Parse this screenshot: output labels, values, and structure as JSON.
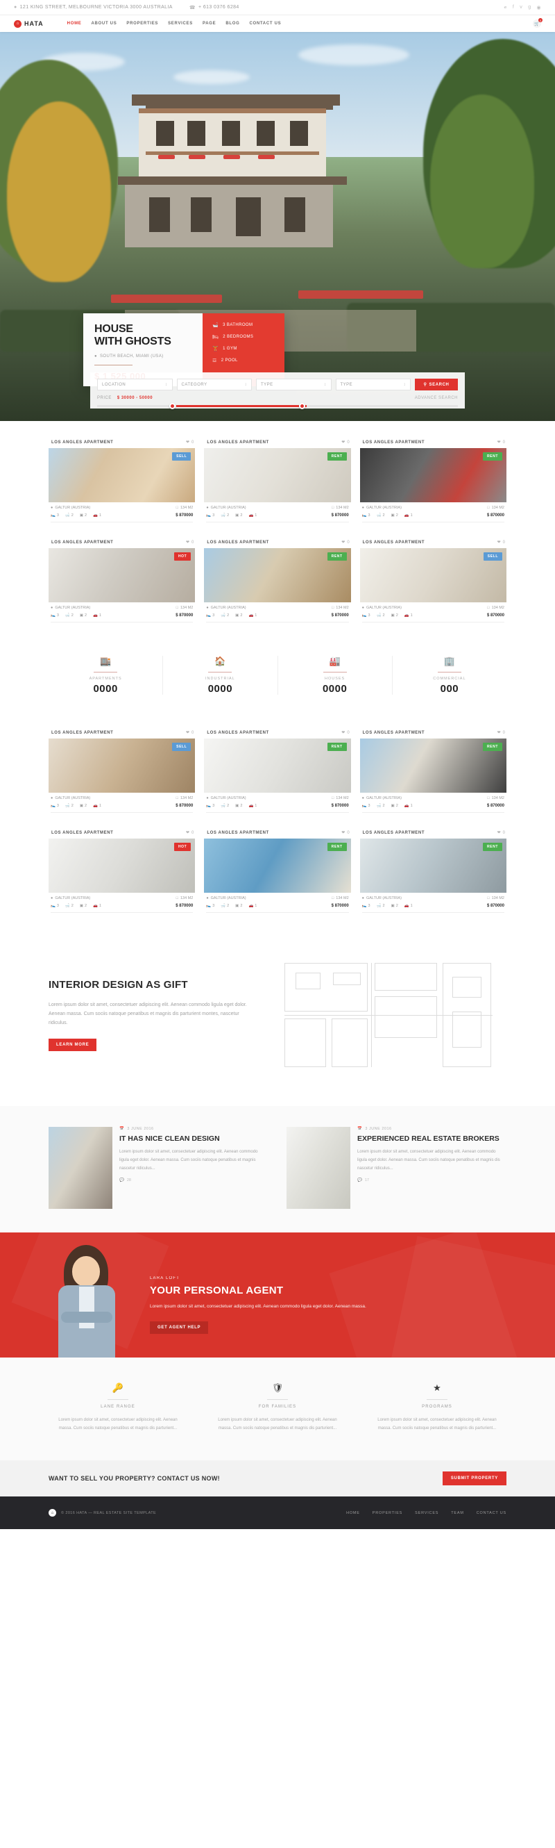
{
  "topbar": {
    "address": "121 KING STREET, MELBOURNE VICTORIA 3000 AUSTRALIA",
    "phone": "+ 613 0376 6284",
    "location_icon": "map-pin-icon",
    "phone_icon": "phone-icon",
    "social": [
      "twitter-icon",
      "facebook-icon",
      "vimeo-icon",
      "google-plus-icon",
      "rss-icon"
    ]
  },
  "nav": {
    "logo": "HATA",
    "logo_mark": "home-icon",
    "items": [
      {
        "label": "HOME",
        "active": true
      },
      {
        "label": "ABOUT US",
        "active": false
      },
      {
        "label": "PROPERTIES",
        "active": false
      },
      {
        "label": "SERVICES",
        "active": false
      },
      {
        "label": "PAGE",
        "active": false
      },
      {
        "label": "BLOG",
        "active": false
      },
      {
        "label": "CONTACT US",
        "active": false
      }
    ],
    "cart_icon": "cart-icon",
    "cart_count": "0"
  },
  "hero": {
    "card": {
      "title_line1": "HOUSE",
      "title_line2": "WITH GHOSTS",
      "location_icon": "map-pin-icon",
      "location": "SOUTH BEACH, MIAMI (USA)",
      "price": "$ 1 525 000",
      "features": [
        {
          "icon": "bathtub-icon",
          "label": "3 BATHROOM"
        },
        {
          "icon": "bed-icon",
          "label": "2 BEDROOMS"
        },
        {
          "icon": "gym-icon",
          "label": "1 GYM"
        },
        {
          "icon": "pool-icon",
          "label": "2 POOL"
        }
      ]
    },
    "search": {
      "fields": [
        {
          "placeholder": "LOCATION"
        },
        {
          "placeholder": "CATEGORY"
        },
        {
          "placeholder": "TYPE"
        },
        {
          "placeholder": "TYPE"
        }
      ],
      "search_label": "SEARCH",
      "search_icon": "search-icon",
      "price_label": "PRICE",
      "price_value": "$ 30000 - 50000",
      "advance_label": "ADVANCE SEARCH"
    }
  },
  "properties_row1": [
    {
      "title": "LOS ANGLES APARTMENT",
      "fav": "0",
      "badge": "SELL",
      "badge_type": "b-sell",
      "location": "GALTUR (AUSTRIA)",
      "area": "134 M2",
      "beds": "3",
      "baths": "2",
      "rooms": "2",
      "garage": "1",
      "price": "$ 870000",
      "img": "alpine-living-room"
    },
    {
      "title": "LOS ANGLES APARTMENT",
      "fav": "0",
      "badge": "RENT",
      "badge_type": "b-rent",
      "location": "GALTUR (AUSTRIA)",
      "area": "134 M2",
      "beds": "3",
      "baths": "2",
      "rooms": "2",
      "garage": "1",
      "price": "$ 870000",
      "img": "white-bedroom"
    },
    {
      "title": "LOS ANGLES APARTMENT",
      "fav": "0",
      "badge": "RENT",
      "badge_type": "b-rent",
      "location": "GALTUR (AUSTRIA)",
      "area": "134 M2",
      "beds": "3",
      "baths": "2",
      "rooms": "2",
      "garage": "1",
      "price": "$ 870000",
      "img": "red-sofa-lounge"
    }
  ],
  "properties_row2": [
    {
      "title": "LOS ANGLES APARTMENT",
      "fav": "0",
      "badge": "HOT",
      "badge_type": "b-hot",
      "location": "GALTUR (AUSTRIA)",
      "area": "134 M2",
      "beds": "3",
      "baths": "2",
      "rooms": "2",
      "garage": "1",
      "price": "$ 870000",
      "img": "grey-sofa-room"
    },
    {
      "title": "LOS ANGLES APARTMENT",
      "fav": "0",
      "badge": "RENT",
      "badge_type": "b-rent",
      "location": "GALTUR (AUSTRIA)",
      "area": "134 M2",
      "beds": "3",
      "baths": "2",
      "rooms": "2",
      "garage": "1",
      "price": "$ 870000",
      "img": "mountain-view-room"
    },
    {
      "title": "LOS ANGLES APARTMENT",
      "fav": "0",
      "badge": "SELL",
      "badge_type": "b-sell",
      "location": "GALTUR (AUSTRIA)",
      "area": "134 M2",
      "beds": "3",
      "baths": "2",
      "rooms": "2",
      "garage": "1",
      "price": "$ 870000",
      "img": "bright-living-room"
    }
  ],
  "stats": [
    {
      "icon": "apartment-icon",
      "label": "APARTMENTS",
      "value": "0000"
    },
    {
      "icon": "industrial-icon",
      "label": "INDUSTRIAL",
      "value": "0000"
    },
    {
      "icon": "factory-icon",
      "label": "HOUSES",
      "value": "0000"
    },
    {
      "icon": "commercial-icon",
      "label": "COMMERCIAL",
      "value": "000"
    }
  ],
  "properties_row3": [
    {
      "title": "LOS ANGLES APARTMENT",
      "fav": "0",
      "badge": "SELL",
      "badge_type": "b-sell",
      "location": "GALTUR (AUSTRIA)",
      "area": "134 M2",
      "beds": "3",
      "baths": "2",
      "rooms": "2",
      "garage": "1",
      "price": "$ 870000",
      "img": "wood-bedroom"
    },
    {
      "title": "LOS ANGLES APARTMENT",
      "fav": "0",
      "badge": "RENT",
      "badge_type": "b-rent",
      "location": "GALTUR (AUSTRIA)",
      "area": "134 M2",
      "beds": "3",
      "baths": "2",
      "rooms": "2",
      "garage": "1",
      "price": "$ 870000",
      "img": "white-kitchen"
    },
    {
      "title": "LOS ANGLES APARTMENT",
      "fav": "0",
      "badge": "RENT",
      "badge_type": "b-rent",
      "location": "GALTUR (AUSTRIA)",
      "area": "134 M2",
      "beds": "3",
      "baths": "2",
      "rooms": "2",
      "garage": "1",
      "price": "$ 870000",
      "img": "dark-lounge"
    }
  ],
  "properties_row4": [
    {
      "title": "LOS ANGLES APARTMENT",
      "fav": "0",
      "badge": "HOT",
      "badge_type": "b-hot",
      "location": "GALTUR (AUSTRIA)",
      "area": "134 M2",
      "beds": "3",
      "baths": "2",
      "rooms": "2",
      "garage": "1",
      "price": "$ 870000",
      "img": "minimal-kitchen"
    },
    {
      "title": "LOS ANGLES APARTMENT",
      "fav": "0",
      "badge": "RENT",
      "badge_type": "b-rent",
      "location": "GALTUR (AUSTRIA)",
      "area": "134 M2",
      "beds": "3",
      "baths": "2",
      "rooms": "2",
      "garage": "1",
      "price": "$ 870000",
      "img": "sea-view-balcony"
    },
    {
      "title": "LOS ANGLES APARTMENT",
      "fav": "0",
      "badge": "RENT",
      "badge_type": "b-rent",
      "location": "GALTUR (AUSTRIA)",
      "area": "134 M2",
      "beds": "3",
      "baths": "2",
      "rooms": "2",
      "garage": "1",
      "price": "$ 870000",
      "img": "glass-wall-lounge"
    }
  ],
  "interior": {
    "title": "INTERIOR DESIGN AS GIFT",
    "text": "Lorem ipsum dolor sit amet, consectetuer adipiscing elit. Aenean commodo ligula eget dolor. Aenean massa. Cum sociis natoque penatibus et magnis dis parturient montes, nascetur ridiculus.",
    "button": "LEARN MORE"
  },
  "blog": [
    {
      "date_icon": "calendar-icon",
      "date": "3 JUNE 2016",
      "title": "IT HAS NICE CLEAN DESIGN",
      "text": "Lorem ipsum dolor sit amet, consectetuer adipiscing elit. Aenean commodo ligula eget dolor. Aenean massa. Cum sociis natoque penatibus et magnis nascetur ridiculus...",
      "comments_icon": "comment-icon",
      "comments": "28"
    },
    {
      "date_icon": "calendar-icon",
      "date": "3 JUNE 2016",
      "title": "EXPERIENCED REAL ESTATE BROKERS",
      "text": "Lorem ipsum dolor sit amet, consectetuer adipiscing elit. Aenean commodo ligula eget dolor. Aenean massa. Cum sociis natoque penatibus et magnis dis nascetur ridiculus...",
      "comments_icon": "comment-icon",
      "comments": "17"
    }
  ],
  "agent": {
    "subtitle": "LARA LOFT",
    "title": "YOUR PERSONAL AGENT",
    "text": "Lorem ipsum dolor sit amet, consectetuer adipiscing elit. Aenean commodo ligula eget dolor. Aenean massa.",
    "button": "GET AGENT HELP"
  },
  "services": [
    {
      "icon": "key-icon",
      "title": "LANE RANGE",
      "text": "Lorem ipsum dolor sit amet, consectetuer adipiscing elit. Aenean massa. Cum sociis natoque penatibus et magnis dis parturient..."
    },
    {
      "icon": "shield-icon",
      "title": "FOR FAMILIES",
      "text": "Lorem ipsum dolor sit amet, consectetuer adipiscing elit. Aenean massa. Cum sociis natoque penatibus et magnis dis parturient..."
    },
    {
      "icon": "star-icon",
      "title": "PROGRAMS",
      "text": "Lorem ipsum dolor sit amet, consectetuer adipiscing elit. Aenean massa. Cum sociis natoque penatibus et magnis dis parturient..."
    }
  ],
  "cta": {
    "text": "WANT TO SELL YOU PROPERTY? CONTACT US NOW!",
    "button": "SUBMIT PROPERTY"
  },
  "footer": {
    "logo_mark": "home-icon",
    "copyright": "© 2016 HATA — REAL ESTATE SITE TEMPLATE",
    "menu": [
      "HOME",
      "PROPERTIES",
      "SERVICES",
      "TEAM",
      "CONTACT US"
    ]
  },
  "colors": {
    "accent": "#e0332e",
    "dark": "#26262a",
    "sell": "#5b9bd5",
    "rent": "#4caf50"
  }
}
